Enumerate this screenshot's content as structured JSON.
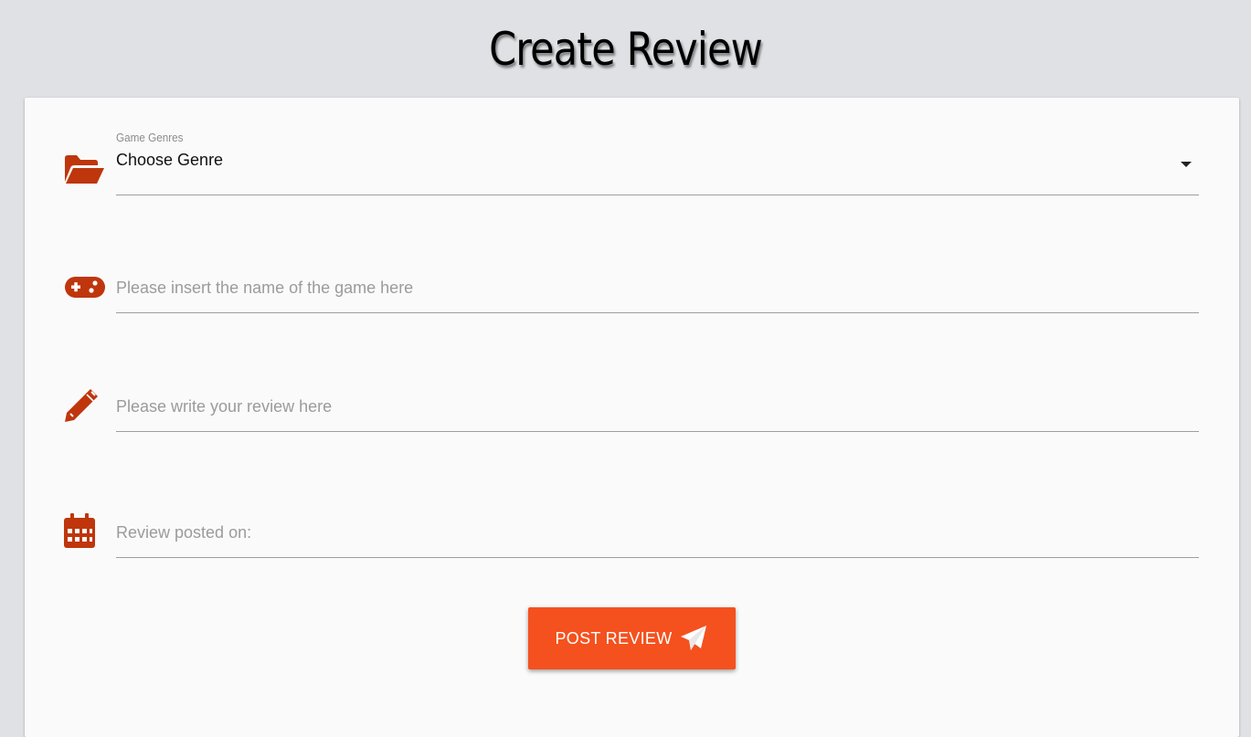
{
  "page": {
    "title": "Create Review"
  },
  "form": {
    "genre": {
      "label": "Game Genres",
      "value": "Choose Genre",
      "icon": "folder-open-icon"
    },
    "game_name": {
      "value": "",
      "placeholder": "Please insert the name of the game here",
      "icon": "gamepad-icon"
    },
    "review": {
      "value": "",
      "placeholder": "Please write your review here",
      "icon": "pencil-icon"
    },
    "posted_on": {
      "value": "",
      "placeholder": "Review posted on:",
      "icon": "calendar-icon"
    },
    "submit": {
      "label": "POST REVIEW",
      "icon": "paper-plane-icon"
    }
  },
  "colors": {
    "page_background": "#e0e1e5",
    "card_background": "#fafafa",
    "icon_color": "#bf360c",
    "button_color": "#f4511e"
  }
}
